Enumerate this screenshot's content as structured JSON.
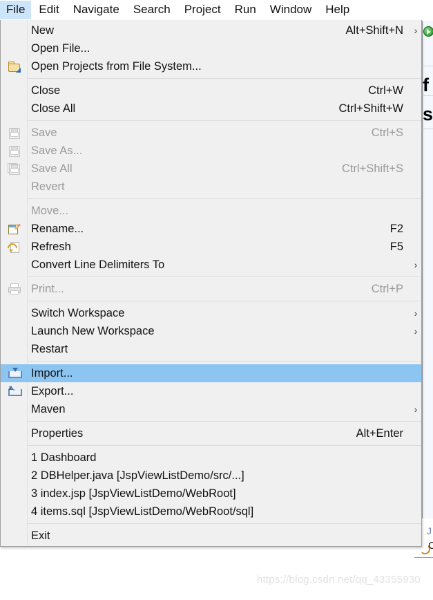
{
  "window": {
    "accent_highlight": "#8dc5f2",
    "menubar_active_bg": "#cde5fa",
    "menu_bg": "#f0f0f0"
  },
  "menubar": {
    "items": [
      {
        "label": "File",
        "active": true
      },
      {
        "label": "Edit",
        "active": false
      },
      {
        "label": "Navigate",
        "active": false
      },
      {
        "label": "Search",
        "active": false
      },
      {
        "label": "Project",
        "active": false
      },
      {
        "label": "Run",
        "active": false
      },
      {
        "label": "Window",
        "active": false
      },
      {
        "label": "Help",
        "active": false
      }
    ]
  },
  "file_menu": {
    "groups": [
      {
        "items": [
          {
            "label": "New",
            "accel": "Alt+Shift+N",
            "submenu": true,
            "disabled": false,
            "selected": false,
            "icon": ""
          },
          {
            "label": "Open File...",
            "accel": "",
            "submenu": false,
            "disabled": false,
            "selected": false,
            "icon": ""
          },
          {
            "label": "Open Projects from File System...",
            "accel": "",
            "submenu": false,
            "disabled": false,
            "selected": false,
            "icon": "folder-import-icon"
          }
        ]
      },
      {
        "items": [
          {
            "label": "Close",
            "accel": "Ctrl+W",
            "submenu": false,
            "disabled": false,
            "selected": false,
            "icon": ""
          },
          {
            "label": "Close All",
            "accel": "Ctrl+Shift+W",
            "submenu": false,
            "disabled": false,
            "selected": false,
            "icon": ""
          }
        ]
      },
      {
        "items": [
          {
            "label": "Save",
            "accel": "Ctrl+S",
            "submenu": false,
            "disabled": true,
            "selected": false,
            "icon": "save-icon"
          },
          {
            "label": "Save As...",
            "accel": "",
            "submenu": false,
            "disabled": true,
            "selected": false,
            "icon": "save-as-icon"
          },
          {
            "label": "Save All",
            "accel": "Ctrl+Shift+S",
            "submenu": false,
            "disabled": true,
            "selected": false,
            "icon": "save-all-icon"
          },
          {
            "label": "Revert",
            "accel": "",
            "submenu": false,
            "disabled": true,
            "selected": false,
            "icon": ""
          }
        ]
      },
      {
        "items": [
          {
            "label": "Move...",
            "accel": "",
            "submenu": false,
            "disabled": true,
            "selected": false,
            "icon": ""
          },
          {
            "label": "Rename...",
            "accel": "F2",
            "submenu": false,
            "disabled": false,
            "selected": false,
            "icon": "rename-icon"
          },
          {
            "label": "Refresh",
            "accel": "F5",
            "submenu": false,
            "disabled": false,
            "selected": false,
            "icon": "refresh-icon"
          },
          {
            "label": "Convert Line Delimiters To",
            "accel": "",
            "submenu": true,
            "disabled": false,
            "selected": false,
            "icon": ""
          }
        ]
      },
      {
        "items": [
          {
            "label": "Print...",
            "accel": "Ctrl+P",
            "submenu": false,
            "disabled": true,
            "selected": false,
            "icon": "print-icon"
          }
        ]
      },
      {
        "items": [
          {
            "label": "Switch Workspace",
            "accel": "",
            "submenu": true,
            "disabled": false,
            "selected": false,
            "icon": ""
          },
          {
            "label": "Launch New Workspace",
            "accel": "",
            "submenu": true,
            "disabled": false,
            "selected": false,
            "icon": ""
          },
          {
            "label": "Restart",
            "accel": "",
            "submenu": false,
            "disabled": false,
            "selected": false,
            "icon": ""
          }
        ]
      },
      {
        "items": [
          {
            "label": "Import...",
            "accel": "",
            "submenu": false,
            "disabled": false,
            "selected": true,
            "icon": "import-icon"
          },
          {
            "label": "Export...",
            "accel": "",
            "submenu": false,
            "disabled": false,
            "selected": false,
            "icon": "export-icon"
          },
          {
            "label": "Maven",
            "accel": "",
            "submenu": true,
            "disabled": false,
            "selected": false,
            "icon": ""
          }
        ]
      },
      {
        "items": [
          {
            "label": "Properties",
            "accel": "Alt+Enter",
            "submenu": false,
            "disabled": false,
            "selected": false,
            "icon": ""
          }
        ]
      },
      {
        "items": [
          {
            "label": "1 Dashboard",
            "accel": "",
            "submenu": false,
            "disabled": false,
            "selected": false,
            "icon": ""
          },
          {
            "label": "2 DBHelper.java  [JspViewListDemo/src/...]",
            "accel": "",
            "submenu": false,
            "disabled": false,
            "selected": false,
            "icon": ""
          },
          {
            "label": "3 index.jsp  [JspViewListDemo/WebRoot]",
            "accel": "",
            "submenu": false,
            "disabled": false,
            "selected": false,
            "icon": ""
          },
          {
            "label": "4 items.sql  [JspViewListDemo/WebRoot/sql]",
            "accel": "",
            "submenu": false,
            "disabled": false,
            "selected": false,
            "icon": ""
          }
        ]
      },
      {
        "items": [
          {
            "label": "Exit",
            "accel": "",
            "submenu": false,
            "disabled": false,
            "selected": false,
            "icon": ""
          }
        ]
      }
    ]
  },
  "background": {
    "bold_text_1": "f",
    "bold_text_2": "s",
    "jsp_text": "J",
    "c_text": "C"
  },
  "watermark": {
    "text": "https://blog.csdn.net/qq_43355930"
  }
}
